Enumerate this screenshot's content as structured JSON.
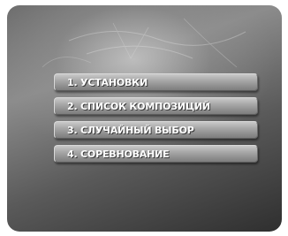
{
  "menu": {
    "items": [
      {
        "label": "1. УСТАНОВКИ"
      },
      {
        "label": "2. СПИСОК КОМПОЗИЦИЙ"
      },
      {
        "label": "3. СЛУЧАЙНЫЙ ВЫБОР"
      },
      {
        "label": "4. СОРЕВНОВАНИЕ"
      }
    ]
  },
  "colors": {
    "label_text": "#ffffff",
    "button_face": "#a3a3a3",
    "background_dark": "#2f2f2f",
    "background_light": "#cdcdcd"
  }
}
